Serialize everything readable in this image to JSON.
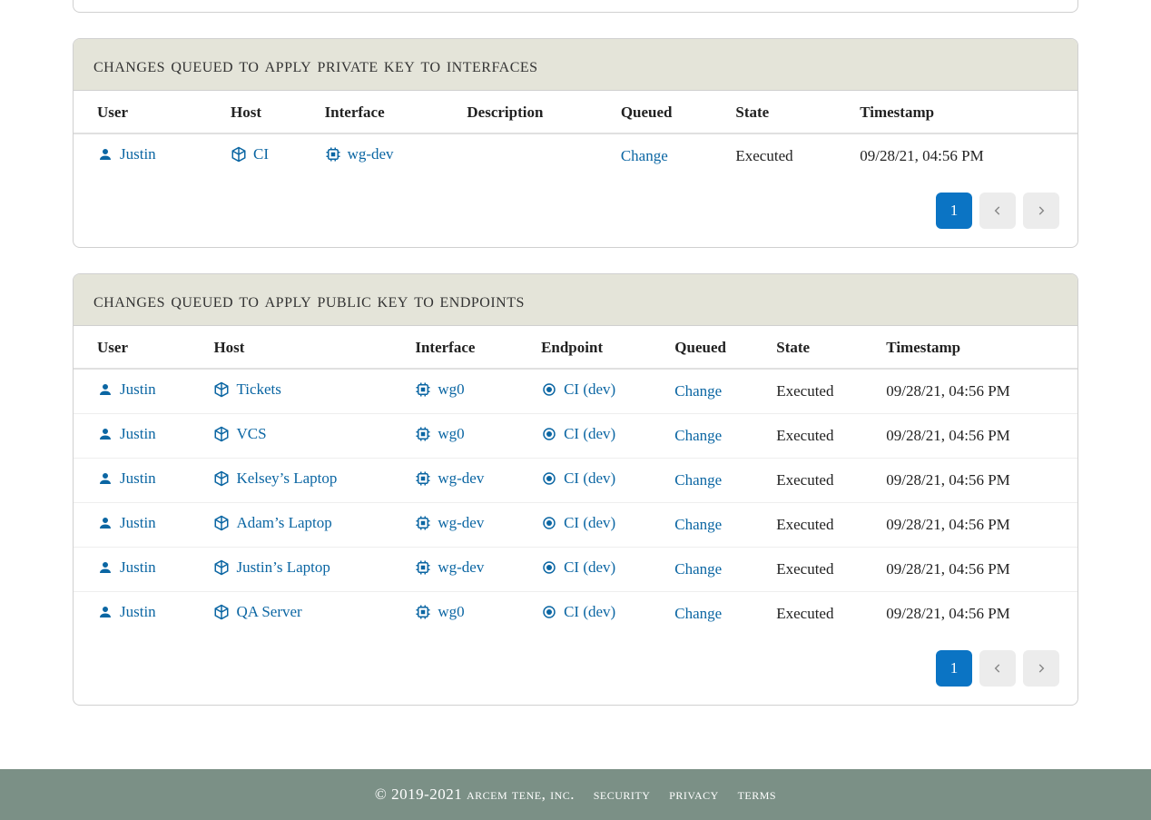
{
  "panel1": {
    "title": "changes queued to apply private key to interfaces",
    "headers": [
      "User",
      "Host",
      "Interface",
      "Description",
      "Queued",
      "State",
      "Timestamp"
    ],
    "rows": [
      {
        "user": "Justin",
        "host": "CI",
        "interface": "wg-dev",
        "description": "",
        "queued": "Change",
        "state": "Executed",
        "timestamp": "09/28/21, 04:56 PM"
      }
    ],
    "page": "1"
  },
  "panel2": {
    "title": "changes queued to apply public key to endpoints",
    "headers": [
      "User",
      "Host",
      "Interface",
      "Endpoint",
      "Queued",
      "State",
      "Timestamp"
    ],
    "rows": [
      {
        "user": "Justin",
        "host": "Tickets",
        "interface": "wg0",
        "endpoint": "CI (dev)",
        "queued": "Change",
        "state": "Executed",
        "timestamp": "09/28/21, 04:56 PM"
      },
      {
        "user": "Justin",
        "host": "VCS",
        "interface": "wg0",
        "endpoint": "CI (dev)",
        "queued": "Change",
        "state": "Executed",
        "timestamp": "09/28/21, 04:56 PM"
      },
      {
        "user": "Justin",
        "host": "Kelsey’s Laptop",
        "interface": "wg-dev",
        "endpoint": "CI (dev)",
        "queued": "Change",
        "state": "Executed",
        "timestamp": "09/28/21, 04:56 PM"
      },
      {
        "user": "Justin",
        "host": "Adam’s Laptop",
        "interface": "wg-dev",
        "endpoint": "CI (dev)",
        "queued": "Change",
        "state": "Executed",
        "timestamp": "09/28/21, 04:56 PM"
      },
      {
        "user": "Justin",
        "host": "Justin’s Laptop",
        "interface": "wg-dev",
        "endpoint": "CI (dev)",
        "queued": "Change",
        "state": "Executed",
        "timestamp": "09/28/21, 04:56 PM"
      },
      {
        "user": "Justin",
        "host": "QA Server",
        "interface": "wg0",
        "endpoint": "CI (dev)",
        "queued": "Change",
        "state": "Executed",
        "timestamp": "09/28/21, 04:56 PM"
      }
    ],
    "page": "1"
  },
  "footer": {
    "copyright": "© 2019-2021 arcem tene, inc.",
    "links": [
      "security",
      "privacy",
      "terms"
    ]
  }
}
